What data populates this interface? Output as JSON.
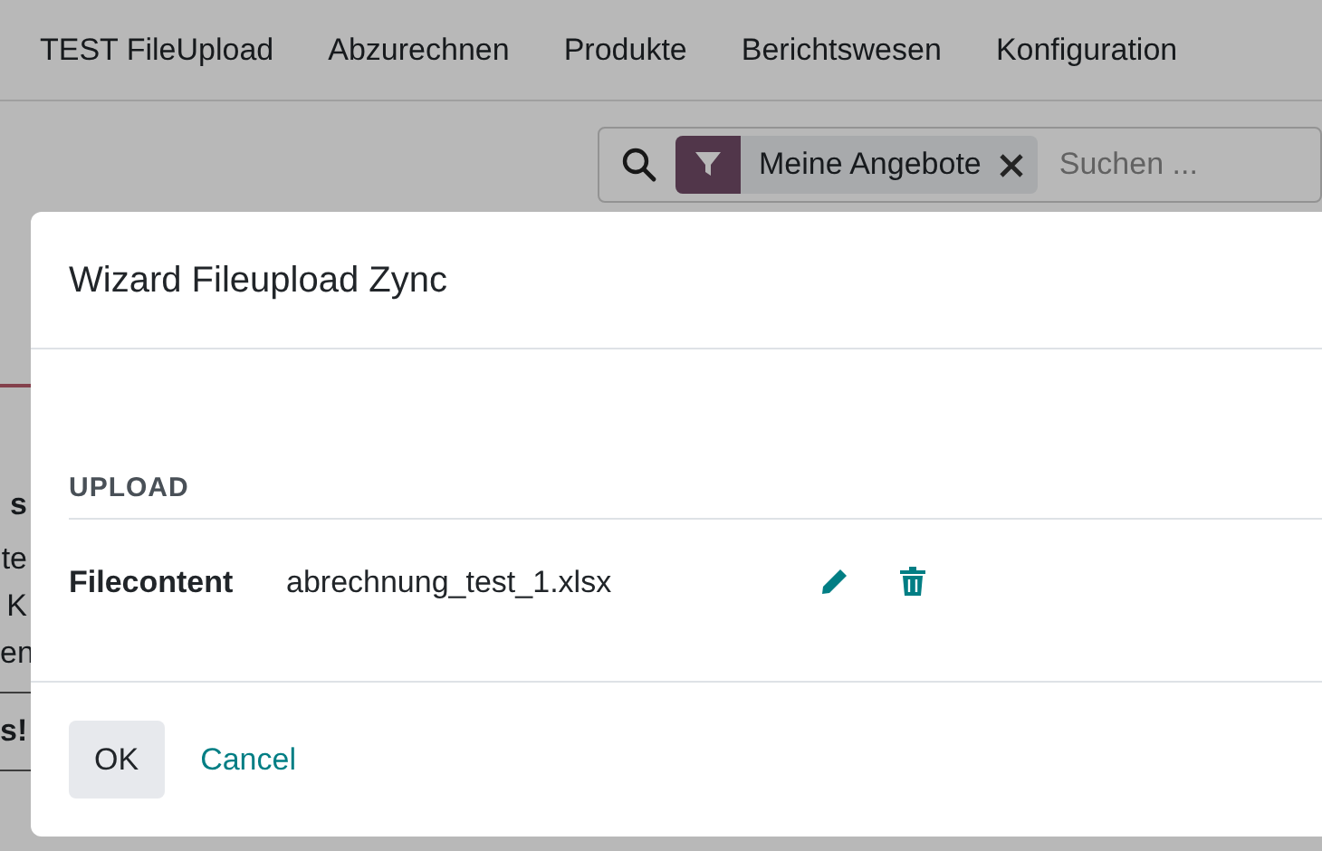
{
  "navbar": {
    "items": [
      "TEST FileUpload",
      "Abzurechnen",
      "Produkte",
      "Berichtswesen",
      "Konfiguration"
    ]
  },
  "search": {
    "facets": [
      {
        "label": "Meine Angebote"
      }
    ],
    "placeholder": "Suchen ..."
  },
  "background_fragments": [
    {
      "text": "s",
      "kind": "heading"
    },
    {
      "text": "te",
      "kind": "line"
    },
    {
      "text": "K",
      "kind": "line"
    },
    {
      "text": "en",
      "kind": "line"
    },
    {
      "text": "s!",
      "kind": "heading"
    }
  ],
  "dialog": {
    "title": "Wizard Fileupload Zync",
    "section": "UPLOAD",
    "fields": [
      {
        "label": "Filecontent",
        "value": "abrechnung_test_1.xlsx"
      }
    ],
    "buttons": [
      {
        "label": "OK",
        "kind": "secondary"
      },
      {
        "label": "Cancel",
        "kind": "link"
      }
    ]
  }
}
